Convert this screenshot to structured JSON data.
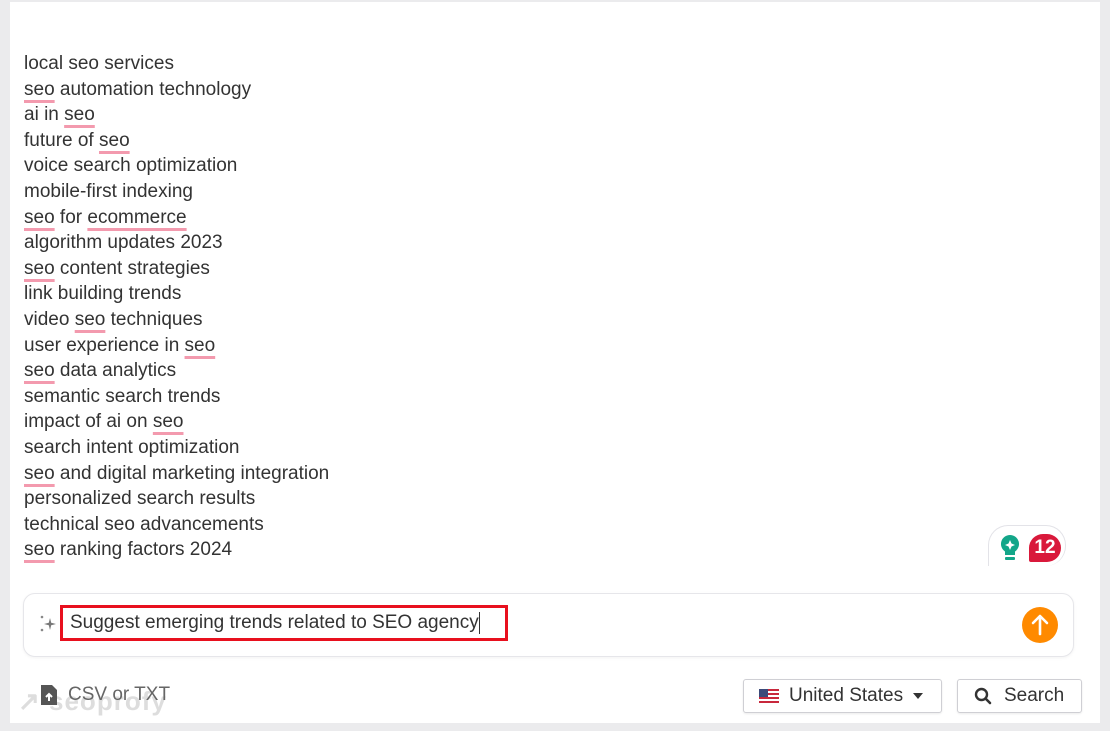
{
  "keywords": [
    [
      {
        "t": "local seo services"
      }
    ],
    [
      {
        "t": "seo",
        "u": true
      },
      {
        "t": " automation technology"
      }
    ],
    [
      {
        "t": "ai in "
      },
      {
        "t": "seo",
        "u": true
      }
    ],
    [
      {
        "t": "future of "
      },
      {
        "t": "seo",
        "u": true
      }
    ],
    [
      {
        "t": "voice search optimization"
      }
    ],
    [
      {
        "t": "mobile-first indexing"
      }
    ],
    [
      {
        "t": "seo",
        "u": true
      },
      {
        "t": " for "
      },
      {
        "t": "ecommerce",
        "u": true
      }
    ],
    [
      {
        "t": "algorithm updates 2023"
      }
    ],
    [
      {
        "t": "seo",
        "u": true
      },
      {
        "t": " content strategies"
      }
    ],
    [
      {
        "t": "link building trends"
      }
    ],
    [
      {
        "t": "video "
      },
      {
        "t": "seo",
        "u": true
      },
      {
        "t": " techniques"
      }
    ],
    [
      {
        "t": "user experience in "
      },
      {
        "t": "seo",
        "u": true
      }
    ],
    [
      {
        "t": "seo",
        "u": true
      },
      {
        "t": " data analytics"
      }
    ],
    [
      {
        "t": "semantic search trends"
      }
    ],
    [
      {
        "t": "impact of ai on "
      },
      {
        "t": "seo",
        "u": true
      }
    ],
    [
      {
        "t": "search intent optimization"
      }
    ],
    [
      {
        "t": "seo",
        "u": true
      },
      {
        "t": " and digital marketing integration"
      }
    ],
    [
      {
        "t": "personalized search results"
      }
    ],
    [
      {
        "t": "technical seo advancements"
      }
    ],
    [
      {
        "t": "seo",
        "u": true
      },
      {
        "t": " ranking factors 2024"
      }
    ]
  ],
  "grammar_badge": {
    "icon": "lightbulb-icon",
    "count": "12",
    "accent": "#d9193b",
    "bulb_color": "#13a689"
  },
  "prompt": {
    "value": "Suggest emerging trends related to SEO agency",
    "icon": "sparkle-icon",
    "send_icon": "arrow-up-icon",
    "send_color": "#ff8a00",
    "highlight_color": "#e8101e"
  },
  "footer": {
    "upload_label": "CSV or TXT",
    "country": "United States",
    "search_label": "Search"
  },
  "watermark": "seoprofy"
}
